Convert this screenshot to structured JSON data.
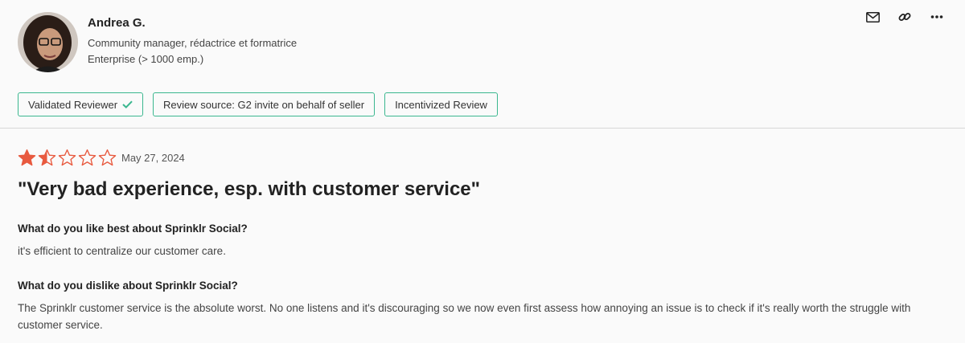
{
  "reviewer": {
    "name": "Andrea G.",
    "role": "Community manager, rédactrice et formatrice",
    "company_size": "Enterprise (> 1000 emp.)"
  },
  "actions": {
    "icons": [
      "mail-icon",
      "link-icon",
      "more-icon"
    ]
  },
  "badges": [
    {
      "label": "Validated Reviewer",
      "icon": "check-icon"
    },
    {
      "label": "Review source: G2 invite on behalf of seller"
    },
    {
      "label": "Incentivized Review"
    }
  ],
  "review": {
    "rating": 1.5,
    "rating_max": 5,
    "star_color": "#e85a3f",
    "date": "May 27, 2024",
    "title": "\"Very bad experience, esp. with customer service\"",
    "q1": "What do you like best about Sprinklr Social?",
    "a1": "it's efficient to centralize our customer care.",
    "q2": "What do you dislike about Sprinklr Social?",
    "a2": "The Sprinklr customer service is the absolute worst. No one listens and it's discouraging so we now even first assess how annoying an issue is to check if it's really worth the struggle with customer service."
  },
  "colors": {
    "badge_border": "#3bb78f",
    "check": "#3bb78f"
  }
}
